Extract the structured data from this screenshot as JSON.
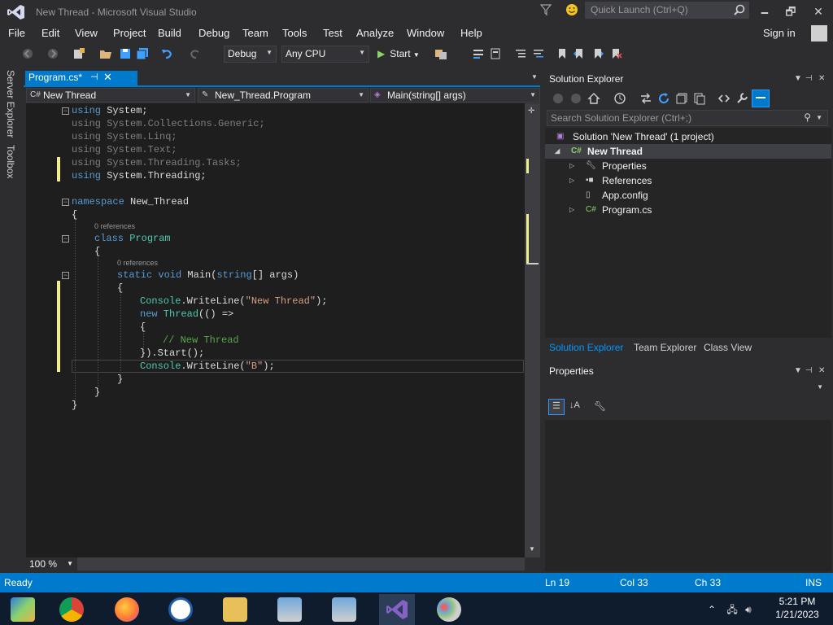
{
  "window": {
    "title": "New Thread - Microsoft Visual Studio",
    "quick_launch_placeholder": "Quick Launch (Ctrl+Q)",
    "minimize": "🗕",
    "restore": "🗗",
    "close": "✕"
  },
  "menu": {
    "items": [
      "File",
      "Edit",
      "View",
      "Project",
      "Build",
      "Debug",
      "Team",
      "Tools",
      "Test",
      "Analyze",
      "Window",
      "Help"
    ],
    "sign_in": "Sign in"
  },
  "toolbar": {
    "configuration": "Debug",
    "platform": "Any CPU",
    "start_label": "Start"
  },
  "sidetabs": {
    "server_explorer": "Server Explorer",
    "toolbox": "Toolbox"
  },
  "editor": {
    "tab_title": "Program.cs*",
    "nav_project": "New Thread",
    "nav_class": "New_Thread.Program",
    "nav_member": "Main(string[] args)",
    "codelens_class": "0 references",
    "codelens_method": "0 references",
    "zoom": "100 %",
    "code": {
      "l1_kw": "using",
      "l1_rest": " System;",
      "l2_kw": "using",
      "l2_rest": " System.Collections.Generic;",
      "l3_kw": "using",
      "l3_rest": " System.Linq;",
      "l4_kw": "using",
      "l4_rest": " System.Text;",
      "l5_kw": "using",
      "l5_rest": " System.Threading.Tasks;",
      "l6_kw": "using",
      "l6_rest": " System.Threading;",
      "l8_kw": "namespace",
      "l8_rest": " New_Thread",
      "l9": "{",
      "l10_kw": "class",
      "l10_type": " Program",
      "l11": "{",
      "l12_kw": "static void",
      "l12_rest": " Main(",
      "l12_kw2": "string",
      "l12_rest2": "[] args)",
      "l13": "{",
      "l14_type": "Console",
      "l14_rest": ".WriteLine(",
      "l14_str": "\"New Thread\"",
      "l14_end": ");",
      "l15_kw": "new",
      "l15_type": " Thread",
      "l15_rest": "(() =>",
      "l16": "{",
      "l17_cmt": "// New Thread",
      "l18": "}).Start();",
      "l19_type": "Console",
      "l19_rest": ".WriteLine(",
      "l19_str": "\"B\"",
      "l19_end": ");",
      "l20": "}",
      "l21": "}",
      "l22": "}"
    }
  },
  "solution_explorer": {
    "title": "Solution Explorer",
    "search_placeholder": "Search Solution Explorer (Ctrl+;)",
    "tree": [
      {
        "label": "Solution 'New Thread' (1 project)",
        "icon": "solution-icon"
      },
      {
        "label": "New Thread",
        "icon": "csharp-project-icon"
      },
      {
        "label": "Properties",
        "icon": "wrench-icon"
      },
      {
        "label": "References",
        "icon": "references-icon"
      },
      {
        "label": "App.config",
        "icon": "config-file-icon"
      },
      {
        "label": "Program.cs",
        "icon": "csharp-file-icon"
      }
    ],
    "tabs": [
      "Solution Explorer",
      "Team Explorer",
      "Class View"
    ]
  },
  "properties": {
    "title": "Properties"
  },
  "status": {
    "state": "Ready",
    "line": "Ln 19",
    "col": "Col 33",
    "ch": "Ch 33",
    "mode": "INS"
  },
  "taskbar": {
    "time": "5:21 PM",
    "date": "1/21/2023"
  },
  "colors": {
    "accent": "#007acc",
    "editor_bg": "#1e1e1e",
    "keyword": "#569cd6",
    "type": "#4ec9b0",
    "string": "#d69d85",
    "comment": "#57a64a"
  }
}
